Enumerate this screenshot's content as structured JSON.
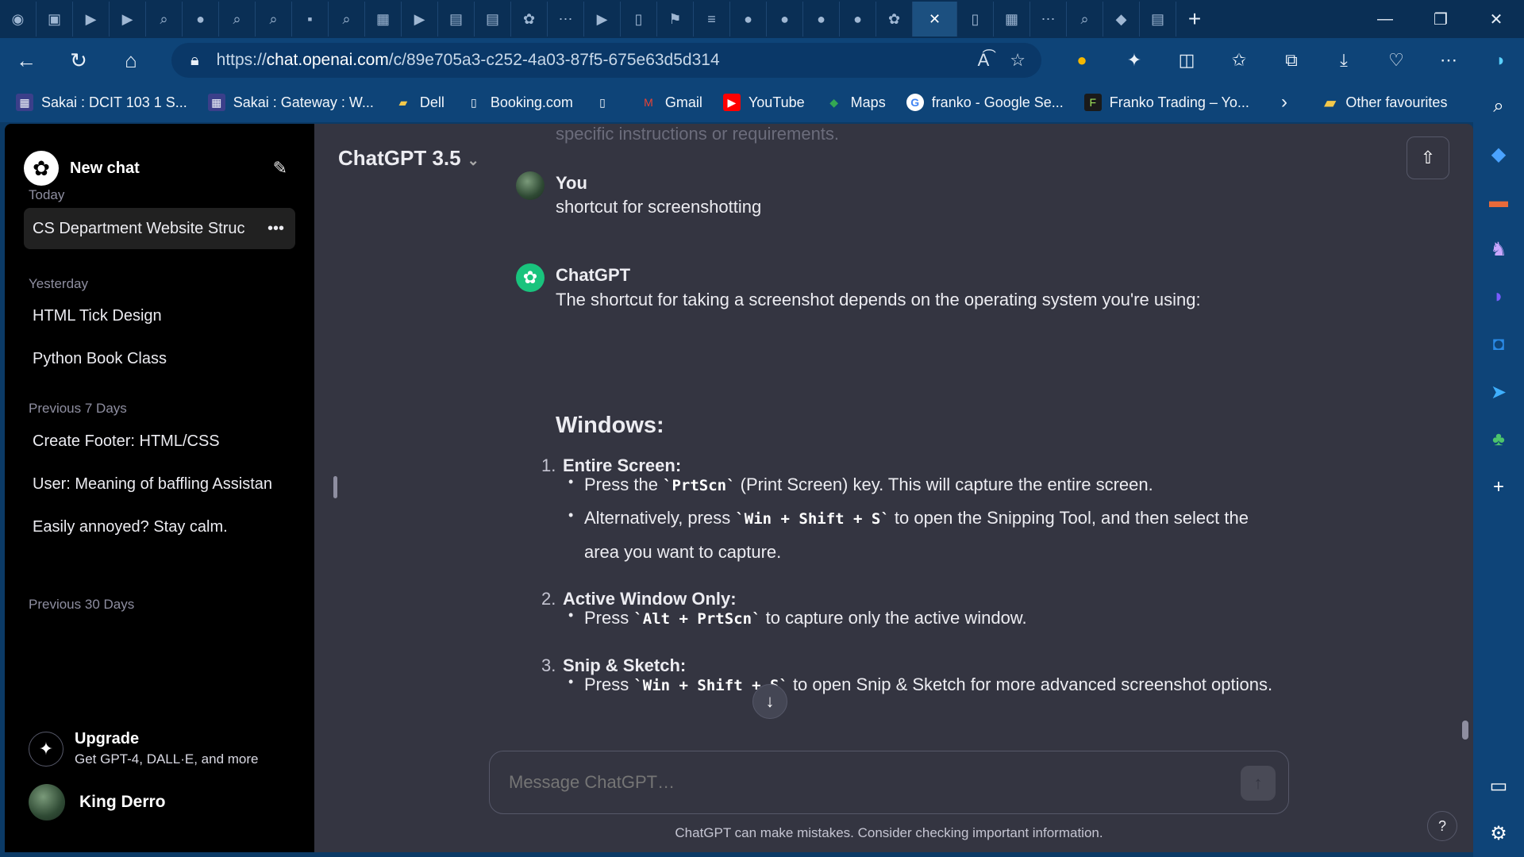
{
  "browser": {
    "url_prefix": "https://",
    "url_host": "chat.openai.com",
    "url_path": "/c/89e705a3-c252-4a03-87f5-675e63d5d314",
    "bookmarks": [
      {
        "label": "Sakai : DCIT 103 1 S...",
        "icon": "sakai-icon"
      },
      {
        "label": "Sakai : Gateway : W...",
        "icon": "sakai-icon"
      },
      {
        "label": "Dell",
        "icon": "folder-icon"
      },
      {
        "label": "Booking.com",
        "icon": "page-icon"
      },
      {
        "label": "",
        "icon": "page-icon"
      },
      {
        "label": "Gmail",
        "icon": "gmail-icon"
      },
      {
        "label": "YouTube",
        "icon": "youtube-icon"
      },
      {
        "label": "Maps",
        "icon": "maps-icon"
      },
      {
        "label": "franko - Google Se...",
        "icon": "google-icon"
      },
      {
        "label": "Franko Trading – Yo...",
        "icon": "franko-icon"
      }
    ],
    "other_favourites": "Other favourites"
  },
  "sidebar": {
    "new_chat": "New chat",
    "sections": [
      {
        "title": "Today",
        "items": [
          "CS Department Website Struc"
        ]
      },
      {
        "title": "Yesterday",
        "items": [
          "HTML Tick Design",
          "Python Book Class"
        ]
      },
      {
        "title": "Previous 7 Days",
        "items": [
          "Create Footer: HTML/CSS",
          "User: Meaning of baffling Assistan",
          "Easily annoyed? Stay calm."
        ]
      },
      {
        "title": "Previous 30 Days",
        "items": []
      }
    ],
    "upgrade_title": "Upgrade",
    "upgrade_sub": "Get GPT-4, DALL·E, and more",
    "user_name": "King Derro"
  },
  "main": {
    "model": "ChatGPT 3.5",
    "faded_prev": "specific instructions or requirements.",
    "user_label": "You",
    "user_msg": "shortcut for screenshotting",
    "gpt_label": "ChatGPT",
    "gpt_intro": "The shortcut for taking a screenshot depends on the operating system you're using:",
    "heading": "Windows:",
    "steps": [
      {
        "num": "1.",
        "title": "Entire Screen:"
      },
      {
        "num": "2.",
        "title": "Active Window Only:"
      },
      {
        "num": "3.",
        "title": "Snip & Sketch:"
      }
    ],
    "b1_pre": "Press the ",
    "b1_code": "`PrtScn`",
    "b1_post": " (Print Screen) key. This will capture the entire screen.",
    "b2_pre": "Alternatively, press ",
    "b2_code": "`Win + Shift + S`",
    "b2_post": " to open the Snipping Tool, and then select the area you want to capture.",
    "b3_pre": "Press ",
    "b3_code": "`Alt + PrtScn`",
    "b3_post": " to capture only the active window.",
    "b4_pre": "Press ",
    "b4_code": "`Win + Shift + S`",
    "b4_post": " to open Snip & Sketch for more advanced screenshot options.",
    "composer_placeholder": "Message ChatGPT…",
    "disclaimer": "ChatGPT can make mistakes. Consider checking important information.",
    "help": "?"
  }
}
